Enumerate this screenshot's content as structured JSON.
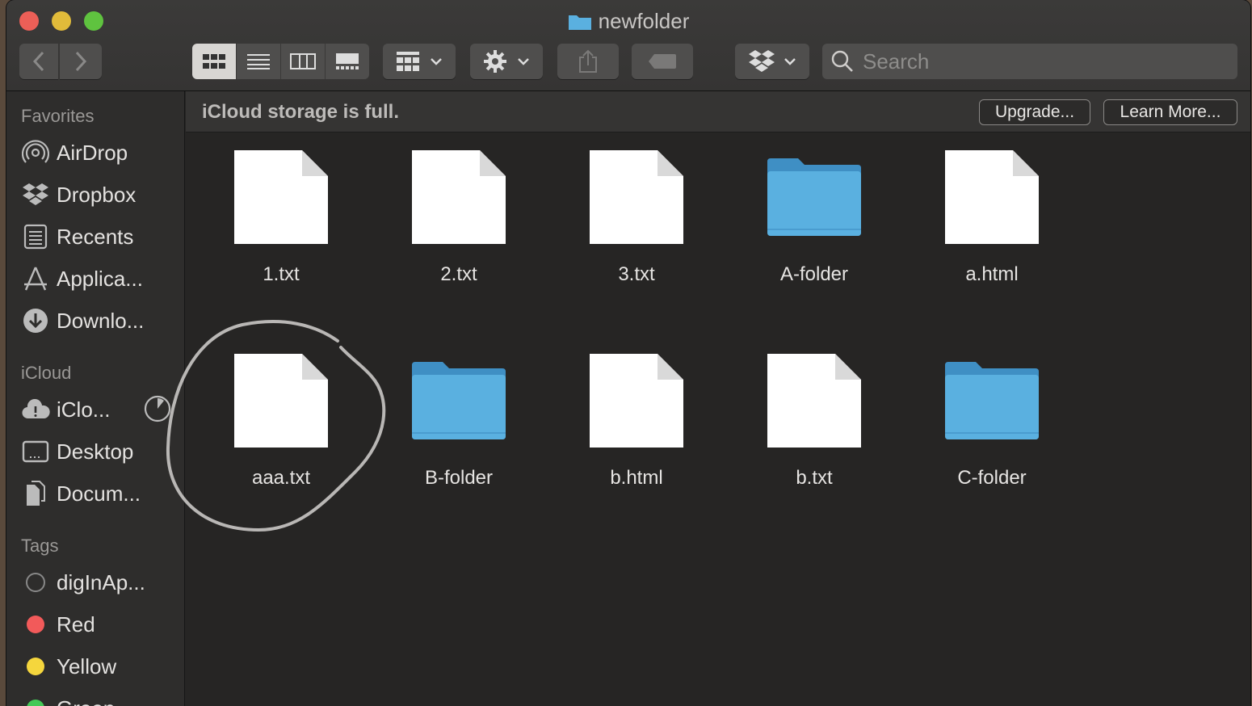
{
  "window": {
    "title": "newfolder"
  },
  "toolbar": {
    "back_icon": "chevron-left-icon",
    "forward_icon": "chevron-right-icon",
    "view_modes": [
      "icon-view",
      "list-view",
      "column-view",
      "gallery-view"
    ],
    "active_view": "icon-view",
    "search_placeholder": "Search"
  },
  "sidebar": {
    "favorites_heading": "Favorites",
    "favorites": [
      {
        "label": "AirDrop",
        "icon": "airdrop-icon"
      },
      {
        "label": "Dropbox",
        "icon": "dropbox-icon"
      },
      {
        "label": "Recents",
        "icon": "recents-icon"
      },
      {
        "label": "Applica...",
        "icon": "applications-icon"
      },
      {
        "label": "Downlo...",
        "icon": "downloads-icon"
      }
    ],
    "icloud_heading": "iCloud",
    "icloud": [
      {
        "label": "iClo...",
        "icon": "icloud-warning-icon"
      },
      {
        "label": "Desktop",
        "icon": "desktop-icon"
      },
      {
        "label": "Docum...",
        "icon": "documents-icon"
      }
    ],
    "tags_heading": "Tags",
    "tags": [
      {
        "label": "digInAp...",
        "color": "#00000000"
      },
      {
        "label": "Red",
        "color": "#f25a5a"
      },
      {
        "label": "Yellow",
        "color": "#f5d63d"
      },
      {
        "label": "Green",
        "color": "#44c957"
      }
    ]
  },
  "banner": {
    "message": "iCloud storage is full.",
    "upgrade_label": "Upgrade...",
    "learn_more_label": "Learn More..."
  },
  "files": [
    {
      "name": "1.txt",
      "kind": "file"
    },
    {
      "name": "2.txt",
      "kind": "file"
    },
    {
      "name": "3.txt",
      "kind": "file"
    },
    {
      "name": "A-folder",
      "kind": "folder"
    },
    {
      "name": "a.html",
      "kind": "file"
    },
    {
      "name": "aaa.txt",
      "kind": "file"
    },
    {
      "name": "B-folder",
      "kind": "folder"
    },
    {
      "name": "b.html",
      "kind": "file"
    },
    {
      "name": "b.txt",
      "kind": "file"
    },
    {
      "name": "C-folder",
      "kind": "folder"
    }
  ],
  "colors": {
    "folder_blue": "#5ab0e0",
    "close": "#ec5f57",
    "minimize": "#e1bb3a",
    "maximize": "#5fc33f"
  }
}
